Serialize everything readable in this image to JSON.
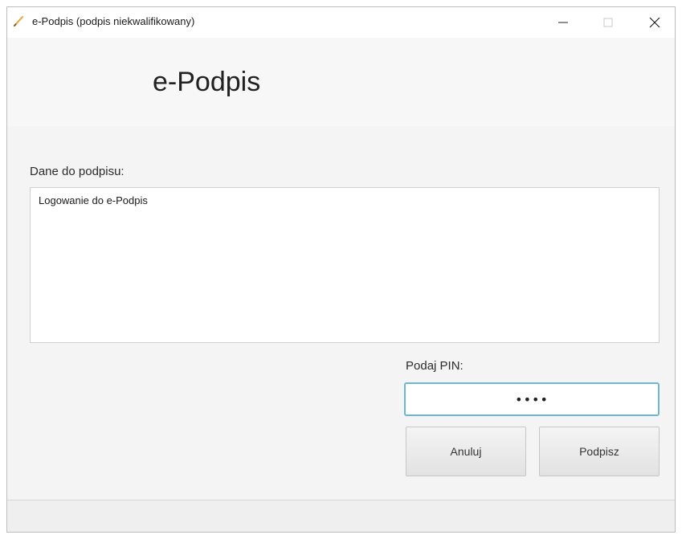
{
  "window": {
    "title": "e-Podpis (podpis niekwalifikowany)",
    "icon": "pen-icon",
    "controls": [
      "minimize-icon",
      "maximize-icon",
      "close-icon"
    ]
  },
  "header": {
    "title": "e-Podpis"
  },
  "form": {
    "data_label": "Dane do podpisu:",
    "data_value": "Logowanie do e-Podpis",
    "pin_label": "Podaj PIN:",
    "pin_value": "••••",
    "cancel_label": "Anuluj",
    "sign_label": "Podpisz"
  },
  "colors": {
    "focus_border": "#6cb6d6",
    "icon_accent": "#e8a33a"
  }
}
